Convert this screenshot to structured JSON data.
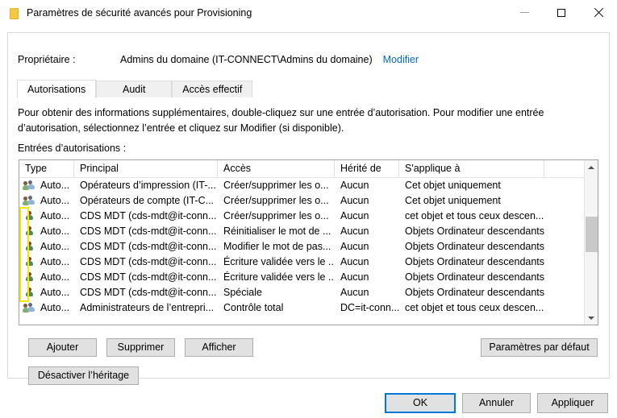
{
  "window": {
    "title": "Paramètres de sécurité avancés pour Provisioning",
    "icon": "folder-icon",
    "minimize_label": "—",
    "maximize_label": "□",
    "close_label": "✕"
  },
  "owner": {
    "label": "Propriétaire :",
    "value": "Admins du domaine (IT-CONNECT\\Admins du domaine)",
    "change_link": "Modifier",
    "link_color": "#0066cc"
  },
  "tabs": [
    {
      "label": "Autorisations",
      "active": true
    },
    {
      "label": "Audit",
      "active": false
    },
    {
      "label": "Accès effectif",
      "active": false
    }
  ],
  "instructions": "Pour obtenir des informations supplémentaires, double-cliquez sur une entrée d’autorisation. Pour modifier une entrée d’autorisation, sélectionnez l’entrée et cliquez sur Modifier (si disponible).",
  "entries_label": "Entrées d’autorisations :",
  "table": {
    "columns": [
      "Type",
      "Principal",
      "Accès",
      "Hérité de",
      "S'applique à",
      ""
    ],
    "rows": [
      {
        "icon": "group-icon",
        "type": "Auto...",
        "principal": "Opérateurs d’impression (IT-...",
        "acces": "Créer/supprimer les o...",
        "herite": "Aucun",
        "applique": "Cet objet uniquement",
        "highlighted": false
      },
      {
        "icon": "group-icon",
        "type": "Auto...",
        "principal": "Opérateurs de compte (IT-C...",
        "acces": "Créer/supprimer les o...",
        "herite": "Aucun",
        "applique": "Cet objet uniquement",
        "highlighted": false
      },
      {
        "icon": "user-icon",
        "type": "Auto...",
        "principal": "CDS MDT (cds-mdt@it-conn...",
        "acces": "Créer/supprimer les o...",
        "herite": "Aucun",
        "applique": "cet objet et tous ceux descen...",
        "highlighted": true
      },
      {
        "icon": "user-icon",
        "type": "Auto...",
        "principal": "CDS MDT (cds-mdt@it-conn...",
        "acces": "Réinitialiser le mot de ...",
        "herite": "Aucun",
        "applique": "Objets Ordinateur descendants",
        "highlighted": true
      },
      {
        "icon": "user-icon",
        "type": "Auto...",
        "principal": "CDS MDT (cds-mdt@it-conn...",
        "acces": "Modifier le mot de pas...",
        "herite": "Aucun",
        "applique": "Objets Ordinateur descendants",
        "highlighted": true
      },
      {
        "icon": "user-icon",
        "type": "Auto...",
        "principal": "CDS MDT (cds-mdt@it-conn...",
        "acces": "Écriture validée vers le ...",
        "herite": "Aucun",
        "applique": "Objets Ordinateur descendants",
        "highlighted": true
      },
      {
        "icon": "user-icon",
        "type": "Auto...",
        "principal": "CDS MDT (cds-mdt@it-conn...",
        "acces": "Écriture validée vers le ...",
        "herite": "Aucun",
        "applique": "Objets Ordinateur descendants",
        "highlighted": true
      },
      {
        "icon": "user-icon",
        "type": "Auto...",
        "principal": "CDS MDT (cds-mdt@it-conn...",
        "acces": "Spéciale",
        "herite": "Aucun",
        "applique": "Objets Ordinateur descendants",
        "highlighted": true
      },
      {
        "icon": "group-icon",
        "type": "Auto...",
        "principal": "Administrateurs de l’entrepri...",
        "acces": "Contrôle total",
        "herite": "DC=it-conn...",
        "applique": "cet objet et tous ceux descen...",
        "highlighted": false
      }
    ],
    "scrollbar": {
      "up_arrow": "scroll-up-icon",
      "down_arrow": "scroll-down-icon",
      "thumb_top_pct": 31,
      "thumb_height_pct": 26
    }
  },
  "buttons": {
    "add": "Ajouter",
    "remove": "Supprimer",
    "view": "Afficher",
    "defaults": "Paramètres par défaut",
    "disable_inheritance": "Désactiver l’héritage",
    "ok": "OK",
    "cancel": "Annuler",
    "apply": "Appliquer"
  },
  "annotation": {
    "color": "#ffe400",
    "target_rows": [
      2,
      8
    ]
  }
}
